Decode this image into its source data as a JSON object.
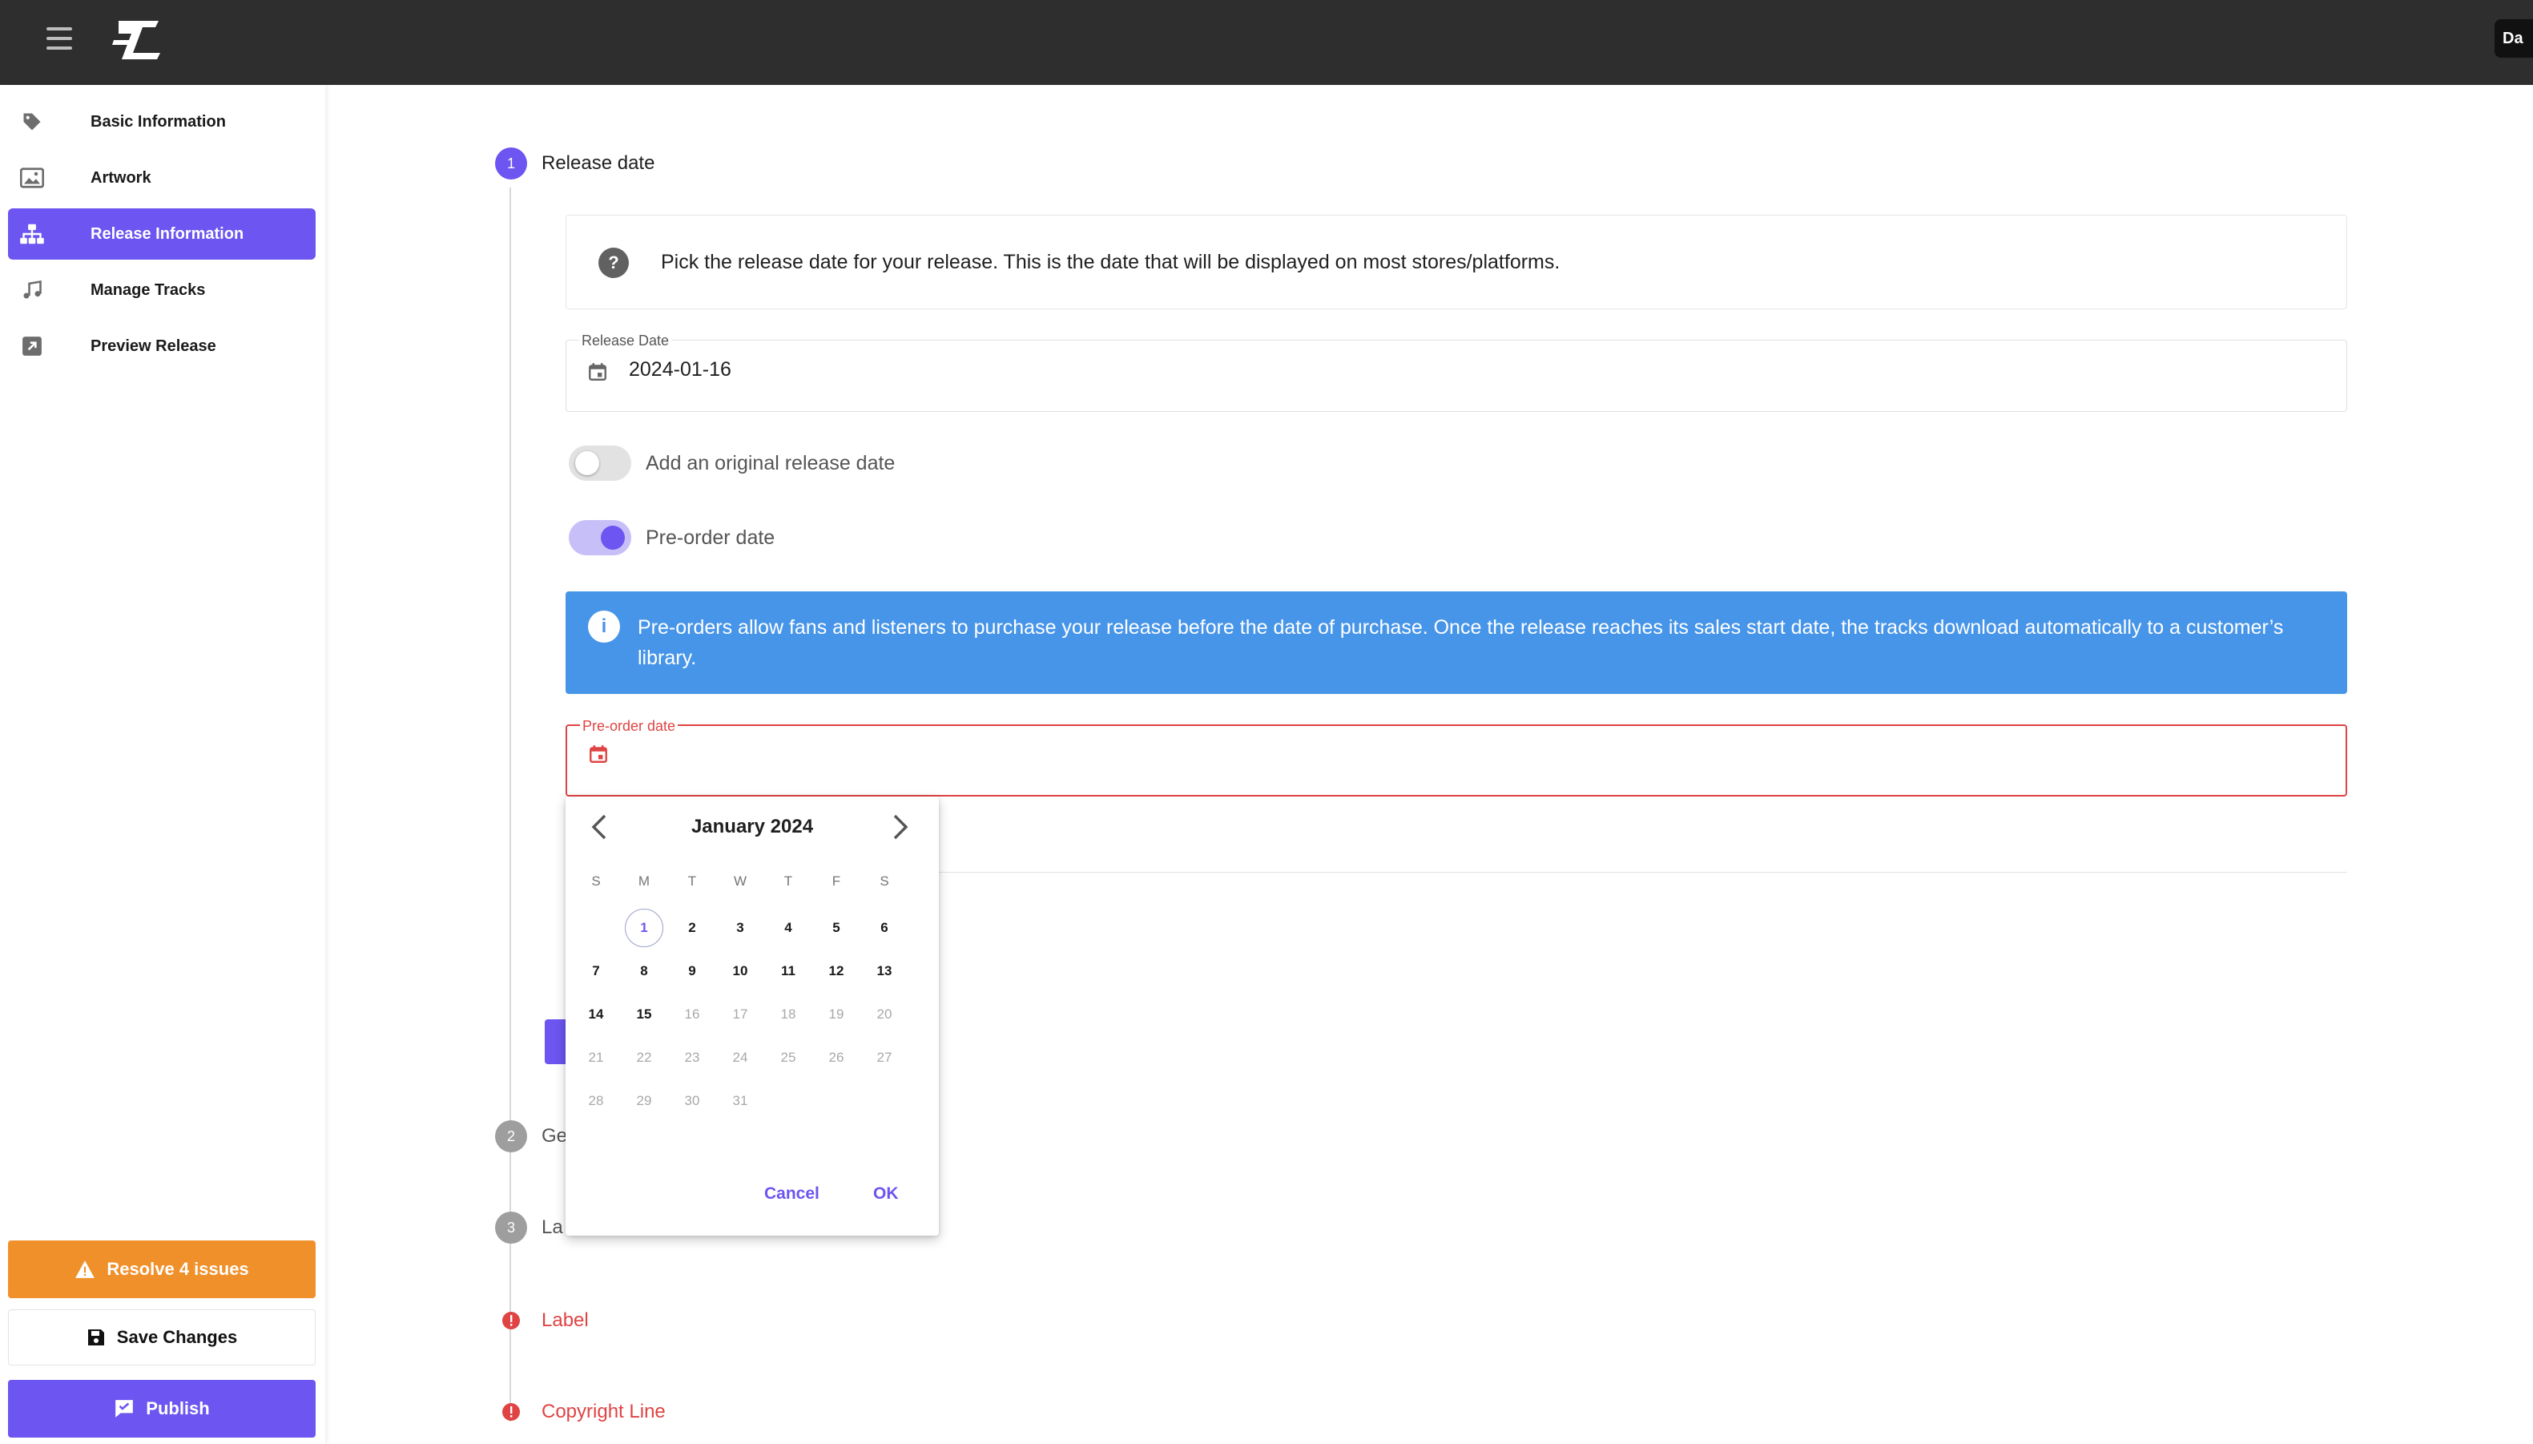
{
  "header": {
    "logo_icon": "label-logo-icon",
    "menu_icon": "hamburger-menu-icon",
    "user_chip_label": "Da"
  },
  "sidebar": {
    "items": [
      {
        "label": "Basic Information",
        "icon": "tag-icon",
        "active": false
      },
      {
        "label": "Artwork",
        "icon": "image-icon",
        "active": false
      },
      {
        "label": "Release Information",
        "icon": "sitemap-icon",
        "active": true
      },
      {
        "label": "Manage Tracks",
        "icon": "music-note-icon",
        "active": false
      },
      {
        "label": "Preview Release",
        "icon": "external-link-icon",
        "active": false
      }
    ],
    "resolve_label": "Resolve 4 issues",
    "save_label": "Save Changes",
    "publish_label": "Publish"
  },
  "steps": [
    {
      "number": "1",
      "title": "Release date",
      "state": "active"
    },
    {
      "number": "2",
      "title": "Ge",
      "state": "inactive"
    },
    {
      "number": "3",
      "title": "La",
      "state": "inactive"
    },
    {
      "number": "",
      "title": "Label",
      "state": "error"
    },
    {
      "number": "",
      "title": "Copyright Line",
      "state": "error"
    }
  ],
  "release_date_step": {
    "help_text": "Pick the release date for your release. This is the date that will be displayed on most stores/platforms.",
    "release_date_label": "Release Date",
    "release_date_value": "2024-01-16",
    "original_release_toggle_label": "Add an original release date",
    "original_release_toggle_on": false,
    "preorder_toggle_label": "Pre-order date",
    "preorder_toggle_on": true,
    "preorder_info": "Pre-orders allow fans and listeners to purchase your release before the date of purchase. Once the release reaches its sales start date, the tracks download automatically to a customer’s library.",
    "preorder_field_label": "Pre-order date",
    "preorder_field_value": ""
  },
  "datepicker": {
    "month_label": "January 2024",
    "weekdays": [
      "S",
      "M",
      "T",
      "W",
      "T",
      "F",
      "S"
    ],
    "first_weekday_index": 1,
    "days_in_month": 31,
    "last_enabled_day": 15,
    "today": 1,
    "cancel_label": "Cancel",
    "ok_label": "OK"
  },
  "colors": {
    "accent": "#6c55f0",
    "warning": "#f0902a",
    "info": "#4795e8",
    "error": "#e04343",
    "topbar": "#2e2e2e"
  }
}
